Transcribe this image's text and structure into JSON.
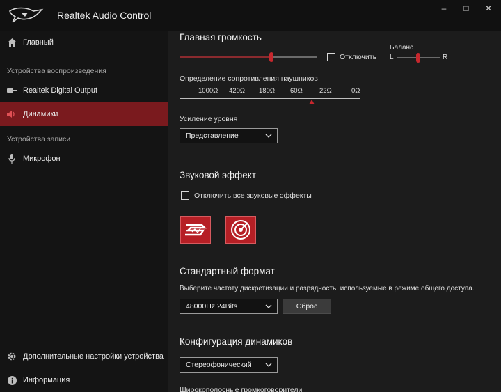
{
  "window": {
    "title": "Realtek Audio Control",
    "controls": {
      "minimize": "–",
      "maximize": "□",
      "close": "✕"
    }
  },
  "sidebar": {
    "home_label": "Главный",
    "playback_section": "Устройства воспроизведения",
    "items_playback": [
      {
        "label": "Realtek Digital Output",
        "icon": "digital-output-icon"
      },
      {
        "label": "Динамики",
        "icon": "speaker-icon",
        "active": true
      }
    ],
    "recording_section": "Устройства записи",
    "items_recording": [
      {
        "label": "Микрофон",
        "icon": "microphone-icon"
      }
    ],
    "advanced_label": "Дополнительные настройки устройства",
    "info_label": "Информация"
  },
  "main": {
    "master_volume": {
      "title": "Главная громкость",
      "mute_label": "Отключить",
      "volume_level": 0.66,
      "balance_label": "Баланс",
      "balance_left": "L",
      "balance_right": "R",
      "balance_level": 0.57
    },
    "impedance": {
      "title": "Определение сопротивления наушников",
      "ticks": [
        "1000Ω",
        "420Ω",
        "180Ω",
        "60Ω",
        "22Ω",
        "0Ω"
      ],
      "indicator_position": 0.73
    },
    "level_boost": {
      "title": "Усиление уровня",
      "selected": "Представление"
    },
    "sound_effect": {
      "title": "Звуковой эффект",
      "disable_all_label": "Отключить все звуковые эффекты",
      "effects": [
        "sonic-studio-icon",
        "sonic-radar-icon"
      ]
    },
    "default_format": {
      "title": "Стандартный формат",
      "description": "Выберите частоту дискретизации и разрядность, используемые в режиме общего доступа.",
      "selected": "48000Hz 24Bits",
      "reset_label": "Сброс"
    },
    "speaker_config": {
      "title": "Конфигурация динамиков",
      "selected": "Стереофонический",
      "next_section": "Широкополосные громкоговорители"
    }
  },
  "colors": {
    "accent": "#c6272d",
    "active_nav": "#7a1a1e",
    "background": "#1c1c1c",
    "sidebar": "#141414"
  }
}
